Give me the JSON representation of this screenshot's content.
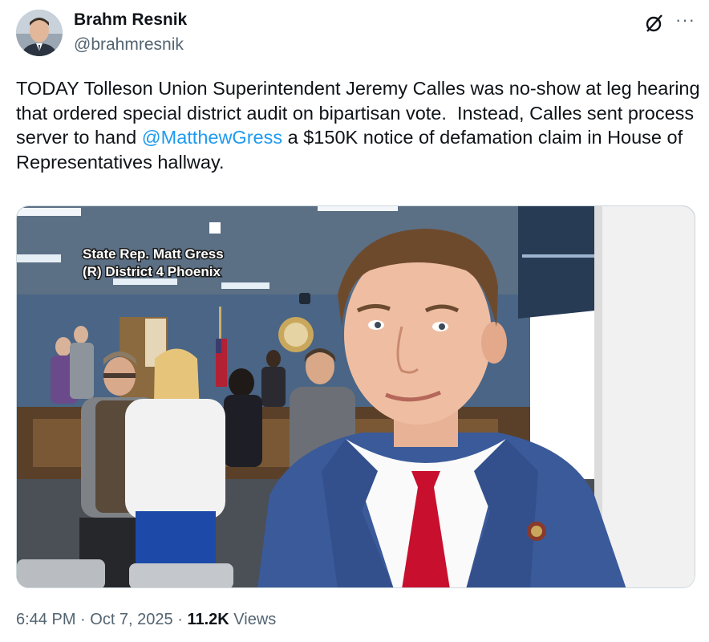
{
  "author": {
    "name": "Brahm Resnik",
    "handle": "@brahmresnik"
  },
  "tweet": {
    "text_before": "TODAY Tolleson Union Superintendent Jeremy Calles was no-show at leg hearing that ordered special district audit on bipartisan vote.  Instead, Calles sent process server to hand ",
    "mention": "@MatthewGress",
    "text_after": " a $150K notice of defamation claim in House of Representatives hallway."
  },
  "video": {
    "caption_line1": "State Rep. Matt Gress",
    "caption_line2": "(R) District 4 Phoenix"
  },
  "meta": {
    "time": "6:44 PM",
    "sep1": " · ",
    "date": "Oct 7, 2025",
    "sep2": " · ",
    "views_count": "11.2K",
    "views_label": " Views"
  },
  "icons": {
    "grok": "grok-icon",
    "more": "more-icon"
  },
  "colors": {
    "link": "#1d9bf0",
    "secondary_text": "#536471",
    "primary_text": "#0f1419"
  }
}
